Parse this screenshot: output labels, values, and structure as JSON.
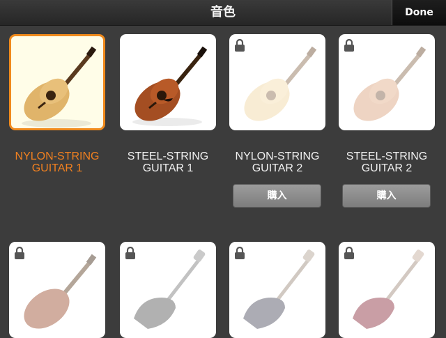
{
  "navbar": {
    "title": "音色",
    "done_label": "Done"
  },
  "instruments": [
    {
      "label": "NYLON-STRING\nGUITAR 1",
      "selected": true,
      "locked": false,
      "type": "acoustic-nylon"
    },
    {
      "label": "STEEL-STRING\nGUITAR 1",
      "selected": false,
      "locked": false,
      "type": "acoustic-steel"
    },
    {
      "label": "NYLON-STRING\nGUITAR 2",
      "selected": false,
      "locked": true,
      "type": "acoustic-nylon",
      "buy_label": "購入"
    },
    {
      "label": "STEEL-STRING\nGUITAR 2",
      "selected": false,
      "locked": true,
      "type": "acoustic-steel",
      "buy_label": "購入"
    },
    {
      "selected": false,
      "locked": true,
      "type": "acoustic-steel"
    },
    {
      "selected": false,
      "locked": true,
      "type": "electric"
    },
    {
      "selected": false,
      "locked": true,
      "type": "electric"
    },
    {
      "selected": false,
      "locked": true,
      "type": "electric-red"
    }
  ],
  "colors": {
    "accent": "#f08a1c",
    "background": "#3c3c3c",
    "label": "#f0f0f0",
    "selected_label": "#f08020"
  },
  "icons": {
    "lock": "lock-icon",
    "acoustic": "acoustic-guitar-icon",
    "electric": "electric-guitar-icon"
  }
}
